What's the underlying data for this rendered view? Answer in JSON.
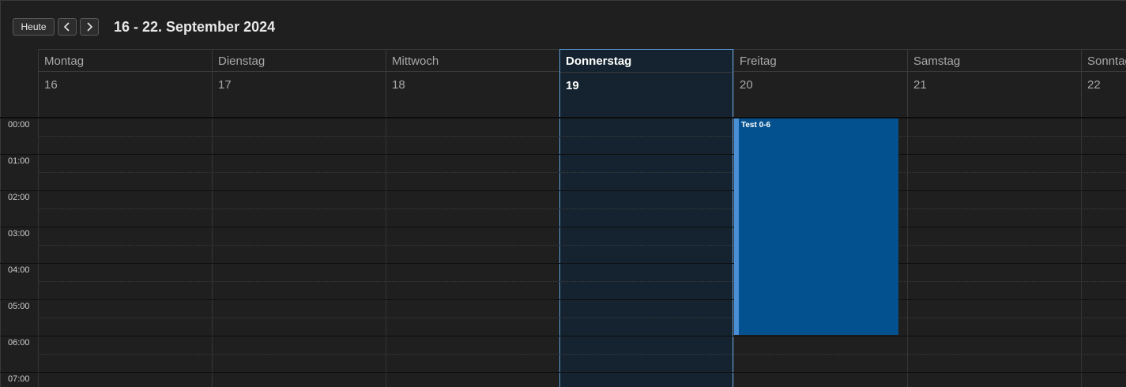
{
  "toolbar": {
    "today_label": "Heute",
    "prev_icon": "chevron-left-icon",
    "next_icon": "chevron-right-icon",
    "range_title": "16 - 22. September 2024"
  },
  "days": [
    {
      "name": "Montag",
      "number": "16"
    },
    {
      "name": "Dienstag",
      "number": "17"
    },
    {
      "name": "Mittwoch",
      "number": "18"
    },
    {
      "name": "Donnerstag",
      "number": "19",
      "today": true
    },
    {
      "name": "Freitag",
      "number": "20"
    },
    {
      "name": "Samstag",
      "number": "21"
    },
    {
      "name": "Sonntag",
      "number": "22"
    }
  ],
  "hours": [
    "00:00",
    "01:00",
    "02:00",
    "03:00",
    "04:00",
    "05:00",
    "06:00",
    "07:00"
  ],
  "events": [
    {
      "title": "Test 0-6",
      "day": "Freitag",
      "start": "00:00",
      "end": "06:00"
    }
  ],
  "colors": {
    "background": "#1f1f1f",
    "today_background": "#14232f",
    "today_border": "#5c9bd6",
    "event_background": "#03528f",
    "event_accent": "#4a8fd6"
  }
}
